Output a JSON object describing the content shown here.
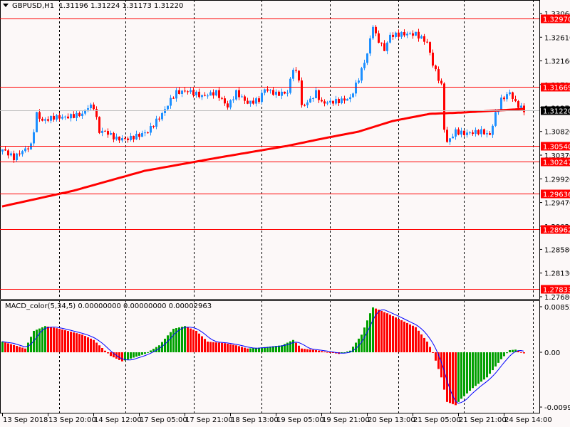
{
  "header": {
    "symbol": "GBPUSD,H1",
    "ohlc": "1.31196 1.31224 1.31173 1.31220"
  },
  "macd_header": "MACD_color(5,34,5) 0.00000000 0.00000000 0.00002963",
  "colors": {
    "bull": "#1e90ff",
    "bear": "#ff0000",
    "level": "#ff0000",
    "ma": "#ff0000",
    "hist_up": "#00a000",
    "hist_down": "#ff0000",
    "signal": "#0000ff",
    "bg": "#fcf8f8"
  },
  "price_axis": [
    "1.33060",
    "1.32610",
    "1.32160",
    "1.31710",
    "1.31270",
    "1.30820",
    "1.30370",
    "1.29920",
    "1.29470",
    "1.29020",
    "1.28580",
    "1.28130",
    "1.27680"
  ],
  "levels": [
    "1.32970",
    "1.31669",
    "1.30540",
    "1.30247",
    "1.29636",
    "1.28962",
    "1.27833"
  ],
  "current_price": "1.31220",
  "macd_axis": [
    "0.008525",
    "0.00",
    "-0.009915"
  ],
  "time_axis": [
    "13 Sep 2018",
    "13 Sep 20:00",
    "14 Sep 12:00",
    "17 Sep 05:00",
    "17 Sep 21:00",
    "18 Sep 13:00",
    "19 Sep 05:00",
    "19 Sep 21:00",
    "20 Sep 13:00",
    "21 Sep 05:00",
    "21 Sep 21:00",
    "24 Sep 14:00"
  ],
  "chart_data": {
    "type": "candlestick",
    "bars": 184,
    "price_range": [
      1.2768,
      1.3306
    ],
    "close_path": [
      [
        0,
        1.3048
      ],
      [
        4,
        1.3032
      ],
      [
        6,
        1.3041
      ],
      [
        10,
        1.3055
      ],
      [
        12,
        1.3115
      ],
      [
        14,
        1.3102
      ],
      [
        18,
        1.3109
      ],
      [
        22,
        1.3109
      ],
      [
        28,
        1.3115
      ],
      [
        30,
        1.3129
      ],
      [
        32,
        1.3129
      ],
      [
        34,
        1.3082
      ],
      [
        36,
        1.3082
      ],
      [
        40,
        1.3068
      ],
      [
        44,
        1.3068
      ],
      [
        48,
        1.3075
      ],
      [
        51,
        1.3082
      ],
      [
        54,
        1.3102
      ],
      [
        56,
        1.3115
      ],
      [
        59,
        1.3142
      ],
      [
        61,
        1.3156
      ],
      [
        65,
        1.3159
      ],
      [
        70,
        1.3149
      ],
      [
        75,
        1.3156
      ],
      [
        79,
        1.3129
      ],
      [
        82,
        1.3156
      ],
      [
        86,
        1.3136
      ],
      [
        90,
        1.3142
      ],
      [
        92,
        1.3163
      ],
      [
        96,
        1.3153
      ],
      [
        100,
        1.3156
      ],
      [
        102,
        1.3203
      ],
      [
        104,
        1.3183
      ],
      [
        105,
        1.3129
      ],
      [
        108,
        1.3142
      ],
      [
        110,
        1.3156
      ],
      [
        112,
        1.3136
      ],
      [
        118,
        1.314
      ],
      [
        122,
        1.3145
      ],
      [
        125,
        1.3183
      ],
      [
        128,
        1.323
      ],
      [
        130,
        1.3284
      ],
      [
        131,
        1.3264
      ],
      [
        134,
        1.3237
      ],
      [
        136,
        1.3264
      ],
      [
        140,
        1.3267
      ],
      [
        145,
        1.3267
      ],
      [
        149,
        1.3251
      ],
      [
        151,
        1.321
      ],
      [
        154,
        1.3169
      ],
      [
        155,
        1.3088
      ],
      [
        156,
        1.3061
      ],
      [
        159,
        1.3082
      ],
      [
        162,
        1.3078
      ],
      [
        168,
        1.3082
      ],
      [
        171,
        1.3075
      ],
      [
        173,
        1.3115
      ],
      [
        175,
        1.3142
      ],
      [
        178,
        1.3156
      ],
      [
        180,
        1.3136
      ],
      [
        183,
        1.3122
      ]
    ],
    "ma200_path": [
      [
        0,
        1.29396
      ],
      [
        25,
        1.29694
      ],
      [
        50,
        1.30072
      ],
      [
        75,
        1.30315
      ],
      [
        100,
        1.30545
      ],
      [
        112,
        1.3068
      ],
      [
        125,
        1.30816
      ],
      [
        137,
        1.31018
      ],
      [
        150,
        1.31154
      ],
      [
        162,
        1.31181
      ],
      [
        183,
        1.31248
      ]
    ],
    "macd": {
      "range": [
        -0.009915,
        0.008525
      ],
      "hist_path": [
        [
          0,
          0.002
        ],
        [
          8,
          0.0007
        ],
        [
          11,
          0.004
        ],
        [
          15,
          0.0049
        ],
        [
          20,
          0.0044
        ],
        [
          28,
          0.0033
        ],
        [
          32,
          0.0023
        ],
        [
          38,
          -0.0007
        ],
        [
          42,
          -0.0017
        ],
        [
          50,
          -0.0003
        ],
        [
          55,
          0.0013
        ],
        [
          60,
          0.0044
        ],
        [
          64,
          0.0049
        ],
        [
          68,
          0.004
        ],
        [
          72,
          0.002
        ],
        [
          78,
          0.0017
        ],
        [
          82,
          0.0013
        ],
        [
          86,
          0.0007
        ],
        [
          91,
          0.0009
        ],
        [
          98,
          0.0013
        ],
        [
          102,
          0.0023
        ],
        [
          105,
          0.0007
        ],
        [
          110,
          0.0004
        ],
        [
          118,
          -0.0003
        ],
        [
          122,
          0.0003
        ],
        [
          126,
          0.0033
        ],
        [
          129,
          0.0073
        ],
        [
          130,
          0.0084
        ],
        [
          135,
          0.0073
        ],
        [
          140,
          0.006
        ],
        [
          145,
          0.0047
        ],
        [
          149,
          0.002
        ],
        [
          151,
          0.0
        ],
        [
          154,
          -0.0047
        ],
        [
          156,
          -0.0093
        ],
        [
          159,
          -0.0099
        ],
        [
          161,
          -0.0087
        ],
        [
          165,
          -0.0067
        ],
        [
          170,
          -0.0047
        ],
        [
          175,
          -0.0013
        ],
        [
          178,
          0.0004
        ],
        [
          180,
          0.0005
        ],
        [
          183,
          -0.0002
        ]
      ]
    }
  }
}
